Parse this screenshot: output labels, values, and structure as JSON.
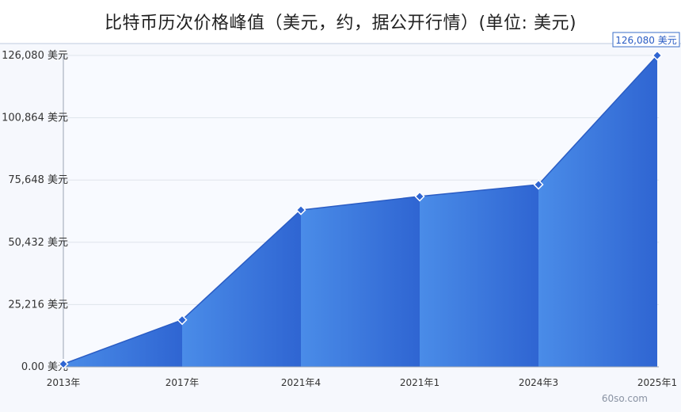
{
  "page": {
    "title": "比特币历次价格峰值（美元，约，据公开行情）(单位: 美元)",
    "watermark": "60so.com"
  },
  "chart_data": {
    "type": "area",
    "title": "比特币历次价格峰值（美元，约，据公开行情）(单位: 美元)",
    "unit": "美元",
    "categories": [
      "2013年",
      "2017年",
      "2021年4",
      "2021年1",
      "2024年3",
      "2025年1"
    ],
    "values": [
      1150,
      19000,
      63500,
      69000,
      73800,
      126080
    ],
    "ylim": [
      0,
      126080
    ],
    "y_ticks": [
      0,
      25216,
      50432,
      75648,
      100864,
      126080
    ],
    "y_tick_labels": [
      "0.00 美元",
      "25,216 美元",
      "50,432 美元",
      "75,648 美元",
      "100,864 美元",
      "126,080 美元"
    ],
    "annotation": "126,080 美元",
    "grid": true,
    "legend": "none",
    "colors": {
      "area_light": "#4a8ce8",
      "area_dark": "#2f65d2",
      "marker": "#2f65d2",
      "annotation_border": "#3a6ec8"
    }
  }
}
